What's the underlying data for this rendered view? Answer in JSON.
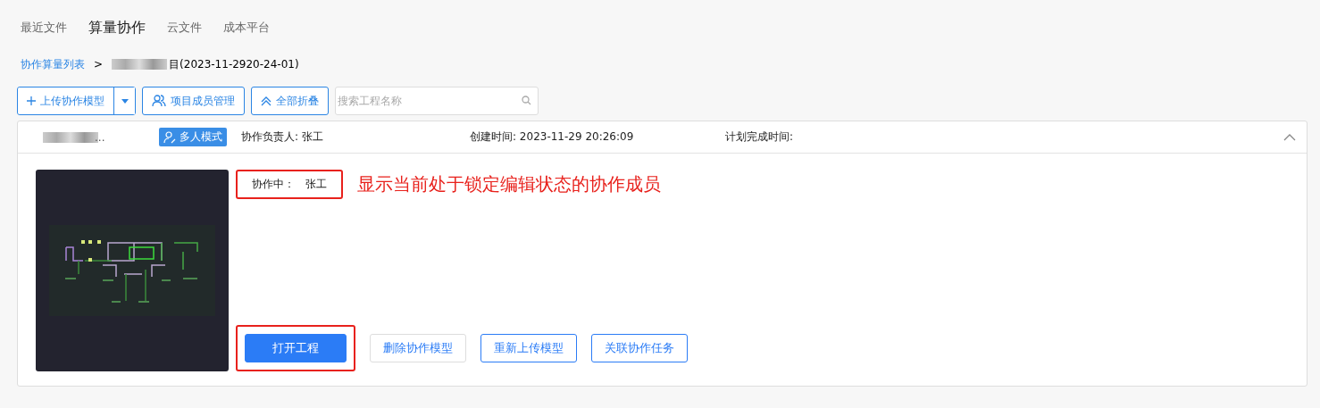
{
  "nav_tabs": [
    {
      "label": "最近文件",
      "selected": false
    },
    {
      "label": "算量协作",
      "selected": true
    },
    {
      "label": "云文件",
      "selected": false
    },
    {
      "label": "成本平台",
      "selected": false
    }
  ],
  "breadcrumb": {
    "parent": "协作算量列表",
    "separator": ">",
    "current": "目(2023-11-2920-24-01)"
  },
  "toolbar": {
    "upload_button": "上传协作模型",
    "members_button": "项目成员管理",
    "collapse_button": "全部折叠",
    "search": {
      "placeholder": "搜索工程名称"
    }
  },
  "card": {
    "expanded": true,
    "name": "...",
    "mode_badge": "多人模式",
    "owner": "协作负责人: 张工",
    "created": "创建时间: 2023-11-29 20:26:09",
    "planned": "计划完成时间:",
    "editing_label": "协作中：",
    "editing_user": "张工",
    "annotation": "显示当前处于锁定编辑状态的协作成员",
    "actions": [
      {
        "label": "打开工程",
        "kind": "primary"
      },
      {
        "label": "删除协作模型",
        "kind": "muted"
      },
      {
        "label": "重新上传模型",
        "kind": "outline"
      },
      {
        "label": "关联协作任务",
        "kind": "outline"
      }
    ]
  }
}
